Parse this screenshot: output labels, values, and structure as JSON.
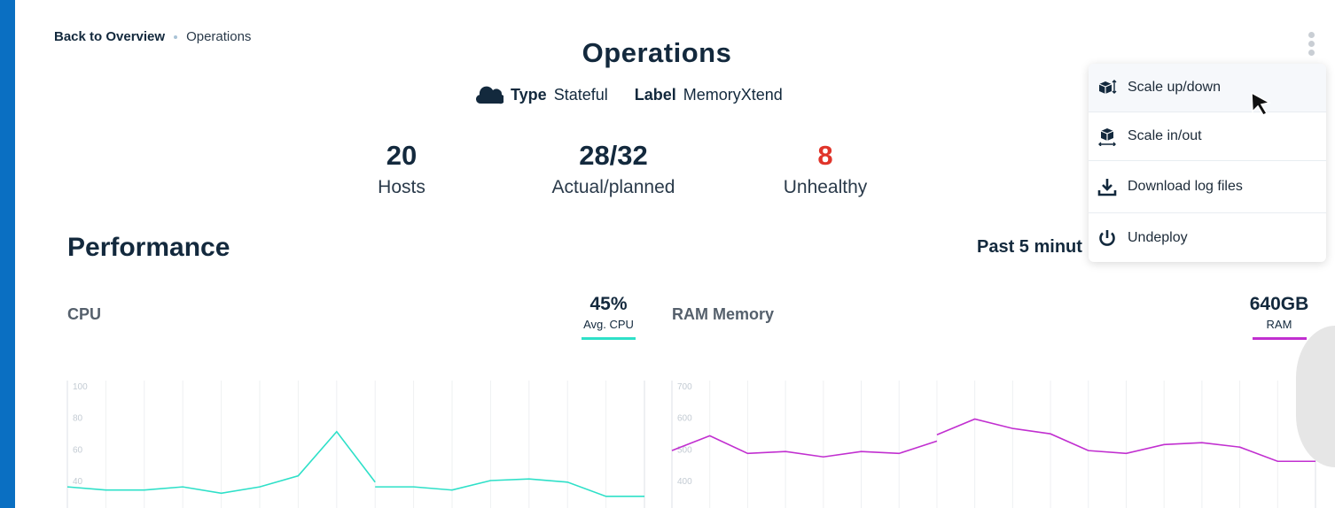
{
  "breadcrumb": {
    "back": "Back to Overview",
    "current": "Operations"
  },
  "page_title": "Operations",
  "meta": {
    "type_label": "Type",
    "type_value": "Stateful",
    "label_label": "Label",
    "label_value": "MemoryXtend",
    "icon": "cloud-icon"
  },
  "stats": [
    {
      "value": "20",
      "label": "Hosts"
    },
    {
      "value": "28/32",
      "label": "Actual/planned"
    },
    {
      "value": "8",
      "label": "Unhealthy"
    }
  ],
  "colors": {
    "accent": "#0a6fc2",
    "danger": "#e0342a",
    "cpu": "#2ee0c8",
    "ram": "#c12fd0",
    "text": "#13293d"
  },
  "performance": {
    "title": "Performance",
    "range": "Past 5 minut"
  },
  "menu": {
    "items": [
      {
        "label": "Scale up/down",
        "icon": "scale-up-down-icon"
      },
      {
        "label": "Scale in/out",
        "icon": "scale-in-out-icon"
      },
      {
        "label": "Download log files",
        "icon": "download-icon"
      },
      {
        "label": "Undeploy",
        "icon": "power-icon"
      }
    ]
  },
  "chart_data": [
    {
      "type": "line",
      "title": "CPU",
      "summary_value": "45%",
      "summary_label": "Avg. CPU",
      "yticks": [
        100,
        80,
        60,
        40
      ],
      "ylim": [
        20,
        100
      ],
      "segments": [
        {
          "start": 0,
          "values": [
            36,
            34,
            34,
            36,
            32,
            36,
            43,
            71,
            39
          ]
        },
        {
          "start": 8,
          "values": [
            36,
            36,
            34,
            40,
            41,
            39,
            30,
            30
          ]
        }
      ],
      "points": 16
    },
    {
      "type": "line",
      "title": "RAM Memory",
      "summary_value": "640GB",
      "summary_label": "RAM",
      "yticks": [
        700,
        600,
        500,
        400
      ],
      "ylim": [
        340,
        700
      ],
      "segments": [
        {
          "start": 0,
          "values": [
            495,
            542,
            486,
            492,
            475,
            492,
            486,
            525
          ]
        },
        {
          "start": 7,
          "values": [
            545,
            595,
            565,
            548,
            495,
            486,
            514,
            520,
            506,
            461,
            461
          ]
        }
      ],
      "points": 18
    }
  ]
}
